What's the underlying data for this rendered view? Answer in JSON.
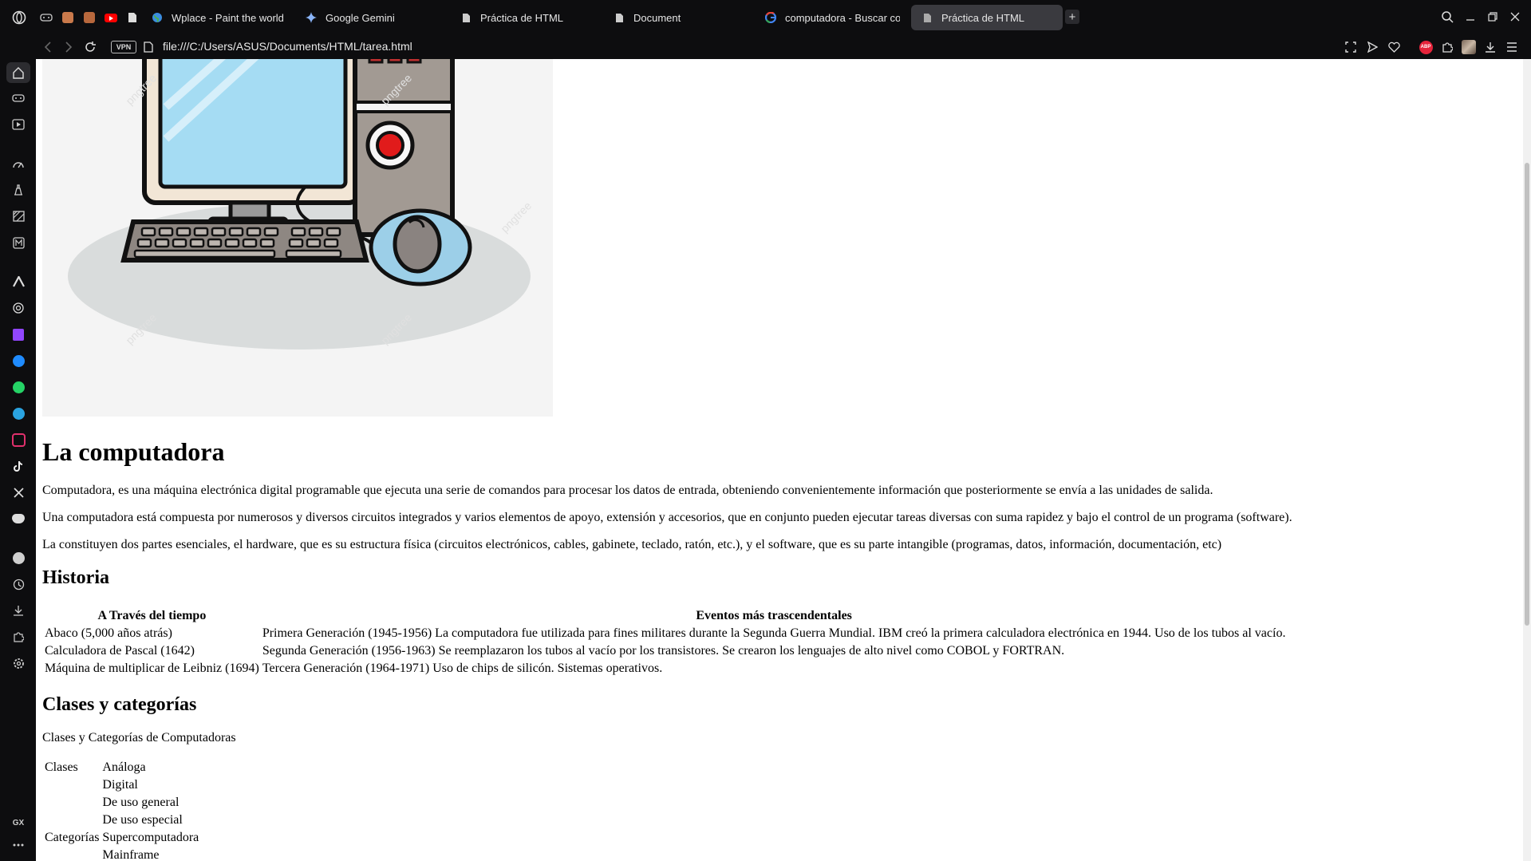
{
  "browser": {
    "tabs": [
      {
        "label": "Wplace - Paint the world",
        "icon": "globe-icon"
      },
      {
        "label": "Google Gemini",
        "icon": "gemini-sparkle-icon"
      },
      {
        "label": "Práctica de HTML",
        "icon": "file-icon"
      },
      {
        "label": "Document",
        "icon": "file-icon"
      },
      {
        "label": "computadora - Buscar co",
        "icon": "google-icon"
      },
      {
        "label": "Práctica de HTML",
        "icon": "file-icon",
        "active": true
      }
    ],
    "vpn_label": "VPN",
    "url": "file:///C:/Users/ASUS/Documents/HTML/tarea.html",
    "adblock_label": "ABP",
    "sidebar_footer_label": "GX",
    "accent_color": "#e5243b"
  },
  "page": {
    "image_watermark": "pngtree",
    "title": "La computadora",
    "intro_paragraphs": [
      "Computadora, es una máquina electrónica digital programable que ejecuta una serie de comandos para procesar los datos de entrada, obteniendo convenientemente información que posteriormente se envía a las unidades de salida.",
      "Una computadora está compuesta por numerosos y diversos circuitos integrados y varios elementos de apoyo, extensión y accesorios, que en conjunto pueden ejecutar tareas diversas con suma rapidez y bajo el control de un programa (software).",
      "La constituyen dos partes esenciales, el hardware, que es su estructura física (circuitos electrónicos, cables, gabinete, teclado, ratón, etc.), y el software, que es su parte intangible (programas, datos, información, documentación, etc)"
    ],
    "history": {
      "heading": "Historia",
      "headers": [
        "A Través del tiempo",
        "Eventos más trascendentales"
      ],
      "rows": [
        [
          "Abaco (5,000 años atrás)",
          "Primera Generación (1945-1956) La computadora fue utilizada para fines militares durante la Segunda Guerra Mundial. IBM creó la primera calculadora electrónica en 1944. Uso de los tubos al vacío."
        ],
        [
          "Calculadora de Pascal (1642)",
          "Segunda Generación (1956-1963) Se reemplazaron los tubos al vacío por los transistores. Se crearon los lenguajes de alto nivel como COBOL y FORTRAN."
        ],
        [
          "Máquina de multiplicar de Leibniz (1694)",
          "Tercera Generación (1964-1971) Uso de chips de silicón. Sistemas operativos."
        ]
      ]
    },
    "classes": {
      "heading": "Clases y categorías",
      "caption": "Clases y Categorías de Computadoras",
      "rows": [
        [
          "Clases",
          "Análoga"
        ],
        [
          "",
          "Digital"
        ],
        [
          "",
          "De uso general"
        ],
        [
          "",
          "De uso especial"
        ],
        [
          "Categorías",
          "Supercomputadora"
        ],
        [
          "",
          "Mainframe"
        ]
      ]
    }
  }
}
